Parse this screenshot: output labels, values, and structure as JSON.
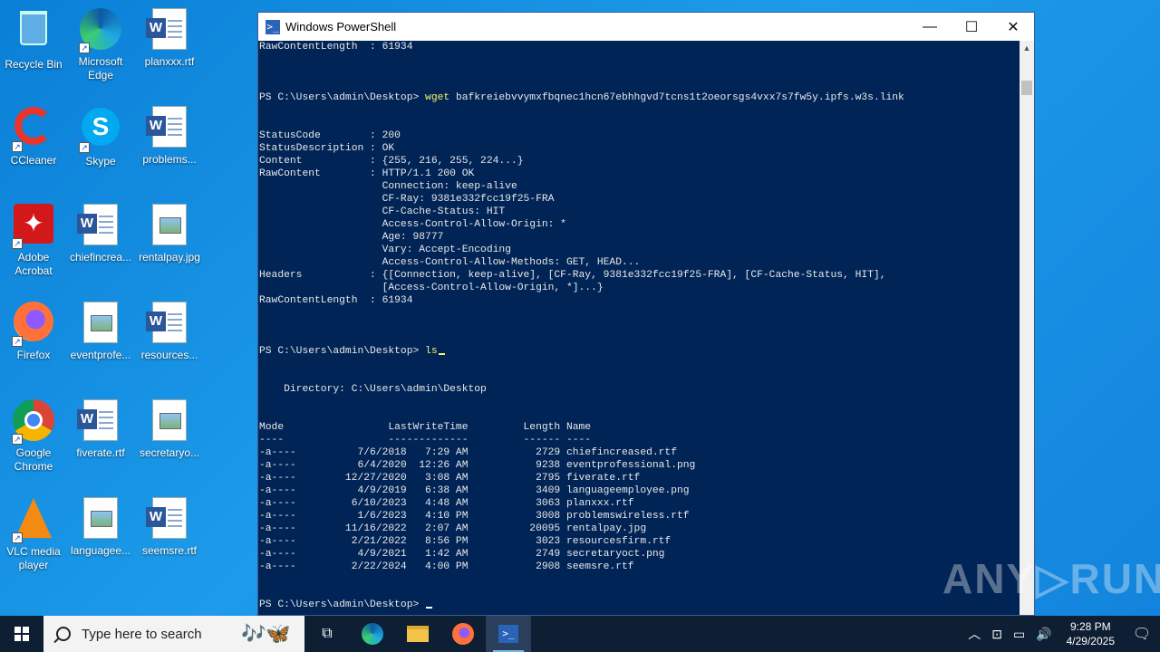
{
  "desktop": {
    "icons": [
      {
        "label": "Recycle Bin"
      },
      {
        "label": "Microsoft Edge"
      },
      {
        "label": "planxxx.rtf"
      },
      {
        "label": "CCleaner"
      },
      {
        "label": "Skype"
      },
      {
        "label": "problems..."
      },
      {
        "label": "Adobe Acrobat"
      },
      {
        "label": "chiefincrea..."
      },
      {
        "label": "rentalpay.jpg"
      },
      {
        "label": "Firefox"
      },
      {
        "label": "eventprofe..."
      },
      {
        "label": "resources..."
      },
      {
        "label": "Google Chrome"
      },
      {
        "label": "fiverate.rtf"
      },
      {
        "label": "secretaryo..."
      },
      {
        "label": "VLC media player"
      },
      {
        "label": "languagee..."
      },
      {
        "label": "seemsre.rtf"
      }
    ]
  },
  "window": {
    "title": "Windows PowerShell",
    "minimize": "—",
    "maximize": "☐",
    "close": "✕"
  },
  "console": {
    "l1": "RawContentLength  : 61934",
    "prompt1": "PS C:\\Users\\admin\\Desktop> ",
    "cmd1": "wget",
    "arg1": " bafkreiebvvymxfbqnec1hcn67ebhhgvd7tcns1t2oeorsgs4vxx7s7fw5y.ipfs.w3s.link",
    "response": "StatusCode        : 200\nStatusDescription : OK\nContent           : {255, 216, 255, 224...}\nRawContent        : HTTP/1.1 200 OK\n                    Connection: keep-alive\n                    CF-Ray: 9381e332fcc19f25-FRA\n                    CF-Cache-Status: HIT\n                    Access-Control-Allow-Origin: *\n                    Age: 98777\n                    Vary: Accept-Encoding\n                    Access-Control-Allow-Methods: GET, HEAD...\nHeaders           : {[Connection, keep-alive], [CF-Ray, 9381e332fcc19f25-FRA], [CF-Cache-Status, HIT],\n                    [Access-Control-Allow-Origin, *]...}\nRawContentLength  : 61934",
    "prompt2": "PS C:\\Users\\admin\\Desktop> ",
    "cmd2": "ls",
    "directory": "    Directory: C:\\Users\\admin\\Desktop",
    "listing": "Mode                 LastWriteTime         Length Name\n----                 -------------         ------ ----\n-a----          7/6/2018   7:29 AM           2729 chiefincreased.rtf\n-a----          6/4/2020  12:26 AM           9238 eventprofessional.png\n-a----        12/27/2020   3:08 AM           2795 fiverate.rtf\n-a----          4/9/2019   6:38 AM           3409 languageemployee.png\n-a----         6/10/2023   4:48 AM           3063 planxxx.rtf\n-a----          1/6/2023   4:10 PM           3008 problemswireless.rtf\n-a----        11/16/2022   2:07 AM          20095 rentalpay.jpg\n-a----         2/21/2022   8:56 PM           3023 resourcesfirm.rtf\n-a----          4/9/2021   1:42 AM           2749 secretaryoct.png\n-a----         2/22/2024   4:00 PM           2908 seemsre.rtf",
    "prompt3": "PS C:\\Users\\admin\\Desktop> "
  },
  "watermark": "ANY▷RUN",
  "taskbar": {
    "search_placeholder": "Type here to search",
    "time": "9:28 PM",
    "date": "4/29/2025"
  },
  "icons": {
    "start": "windows-logo-icon",
    "search": "search-icon",
    "task_view": "task-view-icon",
    "edge": "edge-icon",
    "explorer": "folder-icon",
    "firefox": "firefox-icon",
    "powershell": "powershell-icon"
  },
  "colors": {
    "console_bg": "#012456",
    "command_yellow": "#f5f56a",
    "desktop_blue": "#1283dc",
    "taskbar": "#0e1e33"
  }
}
